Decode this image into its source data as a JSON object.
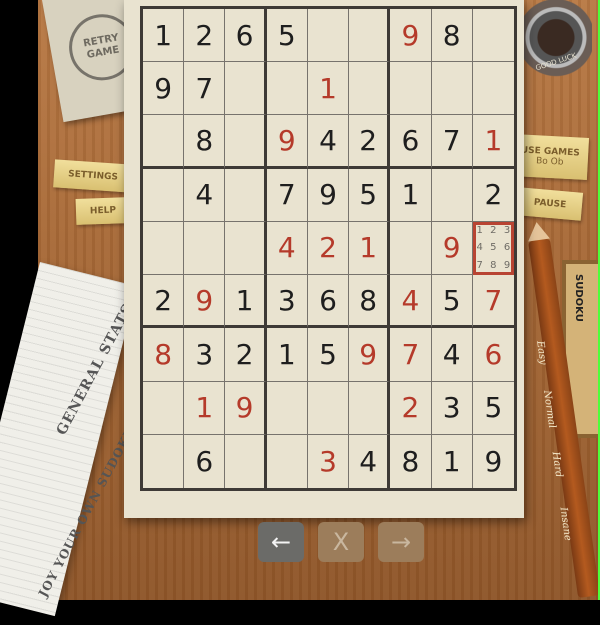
{
  "retry": {
    "label": "RETRY GAME"
  },
  "ink": {
    "label": "GOOD LUCK"
  },
  "left_menu": {
    "settings": "SETTINGS",
    "help": "HELP"
  },
  "right_menu": {
    "top_line1": "USE GAMES",
    "top_line2": "Bo Ob",
    "pause": "PAUSE"
  },
  "papers": {
    "stats": "GENERAL STATS",
    "own": "JOY YOUR OWN SUDOKU"
  },
  "difficulty": {
    "easy": "Easy",
    "normal": "Normal",
    "hard": "Hard",
    "insane": "Insane"
  },
  "side_box": {
    "label": "SUDOKU"
  },
  "nav": {
    "undo": "←",
    "clear": "X",
    "redo": "→"
  },
  "board": {
    "rows": [
      [
        {
          "v": "1",
          "c": "black"
        },
        {
          "v": "2",
          "c": "black"
        },
        {
          "v": "6",
          "c": "black"
        },
        {
          "v": "5",
          "c": "black"
        },
        {
          "v": "",
          "c": "black"
        },
        {
          "v": "",
          "c": "black"
        },
        {
          "v": "9",
          "c": "red"
        },
        {
          "v": "8",
          "c": "black"
        },
        {
          "v": "",
          "c": "black"
        }
      ],
      [
        {
          "v": "9",
          "c": "black"
        },
        {
          "v": "7",
          "c": "black"
        },
        {
          "v": "",
          "c": "black"
        },
        {
          "v": "",
          "c": "black"
        },
        {
          "v": "1",
          "c": "red"
        },
        {
          "v": "",
          "c": "black"
        },
        {
          "v": "",
          "c": "black"
        },
        {
          "v": "",
          "c": "black"
        },
        {
          "v": "",
          "c": "black"
        }
      ],
      [
        {
          "v": "",
          "c": "black"
        },
        {
          "v": "8",
          "c": "black"
        },
        {
          "v": "",
          "c": "black"
        },
        {
          "v": "9",
          "c": "red"
        },
        {
          "v": "4",
          "c": "black"
        },
        {
          "v": "2",
          "c": "black"
        },
        {
          "v": "6",
          "c": "black"
        },
        {
          "v": "7",
          "c": "black"
        },
        {
          "v": "1",
          "c": "red"
        }
      ],
      [
        {
          "v": "",
          "c": "black"
        },
        {
          "v": "4",
          "c": "black"
        },
        {
          "v": "",
          "c": "black"
        },
        {
          "v": "7",
          "c": "black"
        },
        {
          "v": "9",
          "c": "black"
        },
        {
          "v": "5",
          "c": "black"
        },
        {
          "v": "1",
          "c": "black"
        },
        {
          "v": "",
          "c": "black"
        },
        {
          "v": "2",
          "c": "black"
        }
      ],
      [
        {
          "v": "",
          "c": "black"
        },
        {
          "v": "",
          "c": "black"
        },
        {
          "v": "",
          "c": "black"
        },
        {
          "v": "4",
          "c": "red"
        },
        {
          "v": "2",
          "c": "red"
        },
        {
          "v": "1",
          "c": "red"
        },
        {
          "v": "",
          "c": "black"
        },
        {
          "v": "9",
          "c": "red"
        },
        {
          "v": "",
          "c": "black",
          "cand": [
            "1",
            "2",
            "3",
            "4",
            "5",
            "6",
            "7",
            "8",
            "9"
          ],
          "selected": true
        }
      ],
      [
        {
          "v": "2",
          "c": "black"
        },
        {
          "v": "9",
          "c": "red"
        },
        {
          "v": "1",
          "c": "black"
        },
        {
          "v": "3",
          "c": "black"
        },
        {
          "v": "6",
          "c": "black"
        },
        {
          "v": "8",
          "c": "black"
        },
        {
          "v": "4",
          "c": "red"
        },
        {
          "v": "5",
          "c": "black"
        },
        {
          "v": "7",
          "c": "red"
        }
      ],
      [
        {
          "v": "8",
          "c": "red"
        },
        {
          "v": "3",
          "c": "black"
        },
        {
          "v": "2",
          "c": "black"
        },
        {
          "v": "1",
          "c": "black"
        },
        {
          "v": "5",
          "c": "black"
        },
        {
          "v": "9",
          "c": "red"
        },
        {
          "v": "7",
          "c": "red"
        },
        {
          "v": "4",
          "c": "black"
        },
        {
          "v": "6",
          "c": "red"
        }
      ],
      [
        {
          "v": "",
          "c": "black"
        },
        {
          "v": "1",
          "c": "red"
        },
        {
          "v": "9",
          "c": "red"
        },
        {
          "v": "",
          "c": "black"
        },
        {
          "v": "",
          "c": "black"
        },
        {
          "v": "",
          "c": "black"
        },
        {
          "v": "2",
          "c": "red"
        },
        {
          "v": "3",
          "c": "black"
        },
        {
          "v": "5",
          "c": "black"
        }
      ],
      [
        {
          "v": "",
          "c": "black"
        },
        {
          "v": "6",
          "c": "black"
        },
        {
          "v": "",
          "c": "black"
        },
        {
          "v": "",
          "c": "black"
        },
        {
          "v": "3",
          "c": "red"
        },
        {
          "v": "4",
          "c": "black"
        },
        {
          "v": "8",
          "c": "black"
        },
        {
          "v": "1",
          "c": "black"
        },
        {
          "v": "9",
          "c": "black"
        }
      ]
    ]
  },
  "colors": {
    "ink_black": "#1e1e1e",
    "ink_red": "#b53a2a",
    "paper": "#e9e3d0",
    "desk": "#a86a38"
  }
}
